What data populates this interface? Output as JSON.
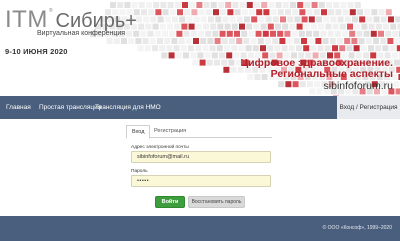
{
  "banner": {
    "logo_itm": "ITM",
    "logo_reg": "®",
    "logo_siberia": "Сибирь+",
    "logo_subtitle": "Виртуальная конференция",
    "dates": "9-10 ИЮНЯ 2020",
    "headline_line1": "Цифровое здравоохранение.",
    "headline_line2": "Региональные аспекты",
    "headline_site": "sibinfoforum.ru"
  },
  "nav": {
    "home": "Главная",
    "simple_stream": "Простая трансляция",
    "nmo_stream": "Трансляция для НМО",
    "login_register": "Вход / Регистрация"
  },
  "form": {
    "tab_login": "Вход",
    "tab_register": "Регистрация",
    "email_label": "Адрес электронной почты",
    "email_value": "sibinfoforum@mail.ru",
    "password_label": "Пароль",
    "password_value": "•••••",
    "login_button": "Войти",
    "restore_button": "Восстановить пароль"
  },
  "footer": {
    "copyright": "© ООО «Консоф», 1999–2020"
  },
  "colors": {
    "nav_bg": "#4a5f7d",
    "accent_red": "#b3202a",
    "button_green": "#3e9e3e",
    "input_bg": "#fbf8d8"
  }
}
